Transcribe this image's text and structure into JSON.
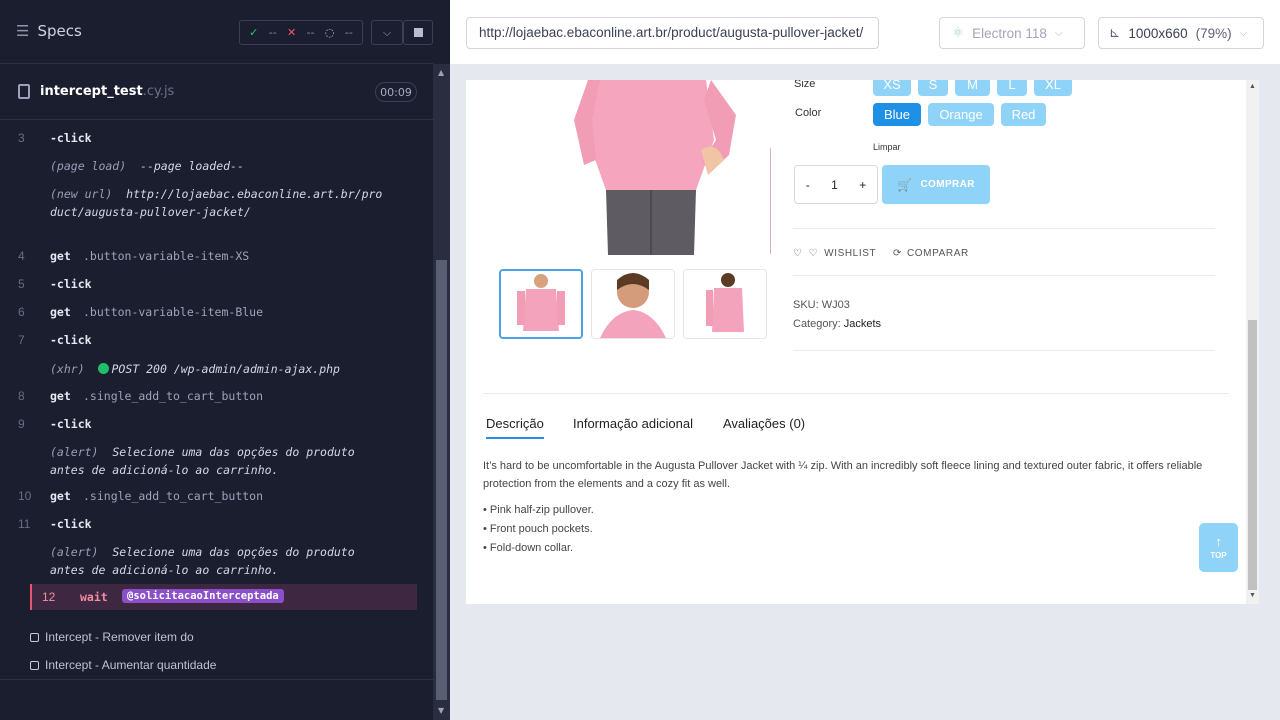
{
  "runner": {
    "title": "Specs",
    "stats": {
      "passed": "--",
      "failed": "--",
      "pending": "--"
    },
    "spec_file": {
      "name": "intercept_test",
      "ext": ".cy.js"
    },
    "timer": "00:09",
    "commands": [
      {
        "num": "3",
        "name": "-click",
        "msg": ""
      },
      {
        "sub_key": "(page load)",
        "sub_val": "--page loaded--"
      },
      {
        "sub_key": "(new url)",
        "sub_val": "http://lojaebac.ebaconline.art.br/product/augusta-pullover-jacket/"
      },
      {
        "num": "4",
        "name": "get",
        "msg": ".button-variable-item-XS"
      },
      {
        "num": "5",
        "name": "-click",
        "msg": ""
      },
      {
        "num": "6",
        "name": "get",
        "msg": ".button-variable-item-Blue"
      },
      {
        "num": "7",
        "name": "-click",
        "msg": ""
      },
      {
        "sub_key": "(xhr)",
        "sub_val": "POST 200 /wp-admin/admin-ajax.php"
      },
      {
        "num": "8",
        "name": "get",
        "msg": ".single_add_to_cart_button"
      },
      {
        "num": "9",
        "name": "-click",
        "msg": ""
      },
      {
        "sub_key": "(alert)",
        "sub_val": "Selecione uma das opções do produto antes de adicioná-lo ao carrinho."
      },
      {
        "num": "10",
        "name": "get",
        "msg": ".single_add_to_cart_button"
      },
      {
        "num": "11",
        "name": "-click",
        "msg": ""
      },
      {
        "sub_key": "(alert)",
        "sub_val": "Selecione uma das opções do produto antes de adicioná-lo ao carrinho."
      }
    ],
    "active_command": {
      "num": "12",
      "name": "wait",
      "alias": "@solicitacaoInterceptada"
    },
    "tests": [
      "Intercept - Remover item do",
      "Intercept - Aumentar quantidade"
    ]
  },
  "browser_bar": {
    "url": "http://lojaebac.ebaconline.art.br/product/augusta-pullover-jacket/",
    "browser": "Electron 118",
    "viewport": "1000x660",
    "scale": "(79%)"
  },
  "product": {
    "size_label": "Size",
    "sizes": [
      "XS",
      "S",
      "M",
      "L",
      "XL"
    ],
    "color_label": "Color",
    "colors": [
      "Blue",
      "Orange",
      "Red"
    ],
    "selected_color": "Blue",
    "clear": "Limpar",
    "qty_minus": "-",
    "qty": "1",
    "qty_plus": "+",
    "buy": "COMPRAR",
    "wishlist": "WISHLIST",
    "compare": "COMPARAR",
    "sku_label": "SKU:",
    "sku": "WJ03",
    "category_label": "Category:",
    "category": "Jackets",
    "tabs": [
      "Descrição",
      "Informação adicional",
      "Avaliações (0)"
    ],
    "description": "It’s hard to be uncomfortable in the Augusta Pullover Jacket with ¼ zip. With an incredibly soft fleece lining and textured outer fabric, it offers reliable protection from the elements and a cozy fit as well.",
    "bullets": [
      "• Pink half-zip pullover.",
      "• Front pouch pockets.",
      "• Fold-down collar."
    ],
    "top_label": "TOP"
  },
  "colors": {
    "runner_bg": "#1b1e2e",
    "accent_blue": "#1e90e6",
    "swatch_light": "#8fd3f8",
    "pass_green": "#21c77a",
    "fail_red": "#ef5a6e",
    "alias_purple": "#8b4fc9"
  }
}
